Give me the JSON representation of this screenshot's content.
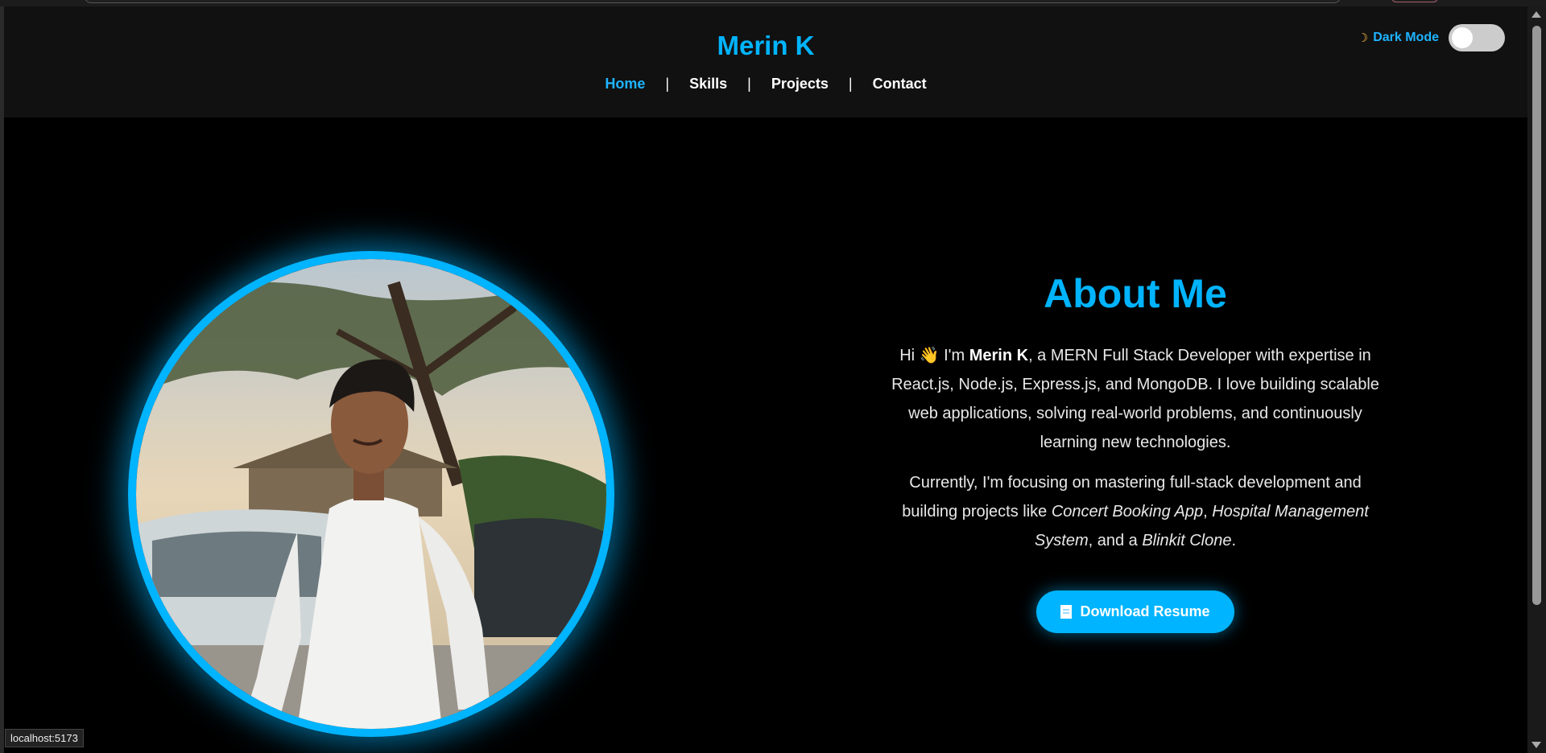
{
  "header": {
    "brand": "Merin K",
    "nav": [
      "Home",
      "Skills",
      "Projects",
      "Contact"
    ],
    "separator": "|",
    "active": "Home",
    "mode_label": "Dark Mode",
    "mode_icon": "moon-icon",
    "toggle_on": false
  },
  "about": {
    "title": "About Me",
    "p1": {
      "greeting": "Hi ",
      "wave": "👋",
      "intro": " I'm ",
      "name": "Merin K",
      "rest": ", a MERN Full Stack Developer with expertise in React.js, Node.js, Express.js, and MongoDB. I love building scalable web applications, solving real-world problems, and continuously learning new technologies."
    },
    "p2": {
      "start": "Currently, I'm focusing on mastering full-stack development and building projects like ",
      "proj1": "Concert Booking App",
      "comma": ", ",
      "proj2": "Hospital Management System",
      "mid": ", and a ",
      "proj3": "Blinkit Clone",
      "end": "."
    },
    "button": "Download Resume",
    "button_icon": "document-icon"
  },
  "status_bar": "localhost:5173",
  "colors": {
    "accent": "#00b4ff",
    "header_bg": "#111111",
    "page_bg": "#000000"
  }
}
